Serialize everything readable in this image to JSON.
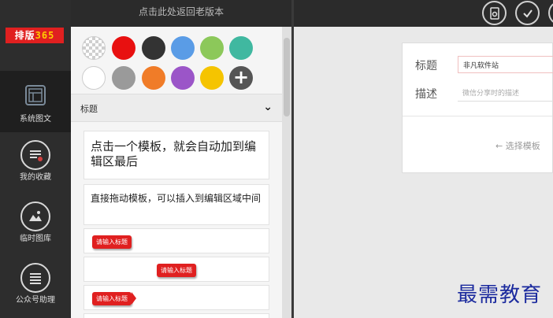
{
  "header": {
    "back_to_old_version": "点击此处返回老版本"
  },
  "logo": {
    "text_prefix": "排版",
    "text_number": "365"
  },
  "nav": {
    "items": [
      {
        "label": "系统图文",
        "icon": "layout-icon"
      },
      {
        "label": "我的收藏",
        "icon": "favorites-list-icon"
      },
      {
        "label": "临时图库",
        "icon": "image-gallery-icon"
      },
      {
        "label": "公众号助理",
        "icon": "assistant-list-icon"
      }
    ]
  },
  "palette": {
    "colors": [
      "transparent",
      "#e81010",
      "#333333",
      "#5a9ce6",
      "#8cc85a",
      "#40b8a0",
      "#ffffff",
      "#9a9a9a",
      "#f07c28",
      "#9b55c8",
      "#f5c400",
      "add"
    ]
  },
  "section": {
    "label": "标题"
  },
  "templates": {
    "card1": "点击一个模板，就会自动加到编辑区最后",
    "card2": "直接拖动模板，可以插入到编辑区域中间",
    "tag_label": "请输入标题"
  },
  "editor": {
    "title_label": "标题",
    "title_value": "非凡软件站",
    "desc_label": "描述",
    "desc_placeholder": "微信分享时的描述",
    "hint": "← 选择模板"
  },
  "watermark": "最需教育"
}
